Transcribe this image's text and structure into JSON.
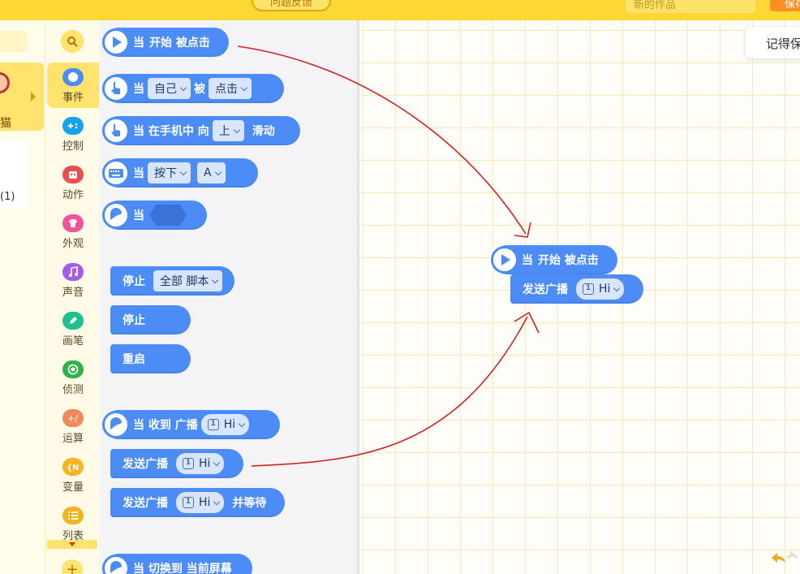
{
  "topbar": {
    "feedback_label": "问题反馈",
    "project_name": "新的作品",
    "save_label": "保存"
  },
  "sprites": {
    "selected_name": "猫",
    "list_count": "(1)"
  },
  "categories": [
    {
      "label": "事件",
      "color": "#4c8cf6",
      "icon": "event-icon"
    },
    {
      "label": "控制",
      "color": "#16a3ee",
      "icon": "control-icon"
    },
    {
      "label": "动作",
      "color": "#e8504f",
      "icon": "motion-icon"
    },
    {
      "label": "外观",
      "color": "#f2539b",
      "icon": "looks-icon"
    },
    {
      "label": "声音",
      "color": "#a45ee6",
      "icon": "sound-icon"
    },
    {
      "label": "画笔",
      "color": "#1fbf8f",
      "icon": "pen-icon"
    },
    {
      "label": "侦测",
      "color": "#32b34a",
      "icon": "sensing-icon"
    },
    {
      "label": "运算",
      "color": "#f08a5d",
      "icon": "operator-icon"
    },
    {
      "label": "变量",
      "color": "#f5b521",
      "icon": "variable-icon"
    },
    {
      "label": "列表",
      "color": "#f5b521",
      "icon": "list-icon"
    }
  ],
  "palette": {
    "when_start_clicked": {
      "when": "当",
      "text": "开始 被点击"
    },
    "when_sprite_clicked": {
      "when": "当",
      "target": "自己",
      "mid": "被",
      "action": "点击"
    },
    "when_swipe": {
      "text": "当 在手机中 向",
      "direction": "上",
      "tail": "滑动"
    },
    "when_key": {
      "when": "当",
      "state": "按下",
      "key": "A"
    },
    "when_condition": {
      "when": "当"
    },
    "stop_all": {
      "label": "停止",
      "option": "全部 脚本"
    },
    "stop": {
      "label": "停止"
    },
    "restart": {
      "label": "重启"
    },
    "when_receive": {
      "text": "当 收到 广播",
      "message": "Hi"
    },
    "broadcast": {
      "label": "发送广播",
      "message": "Hi"
    },
    "broadcast_wait": {
      "label": "发送广播",
      "message": "Hi",
      "tail": "并等待"
    },
    "when_screen": {
      "text": "当 切换到 当前屏幕"
    }
  },
  "workspace": {
    "script_hat": {
      "when": "当",
      "text": "开始 被点击"
    },
    "script_broadcast": {
      "label": "发送广播",
      "message": "Hi"
    },
    "toast": "记得保存",
    "grid_color": "#fbe9b8"
  },
  "colors": {
    "topbar": "#fdd835",
    "event_block": "#4c8cf6",
    "annotation_arrow": "#d42020"
  }
}
